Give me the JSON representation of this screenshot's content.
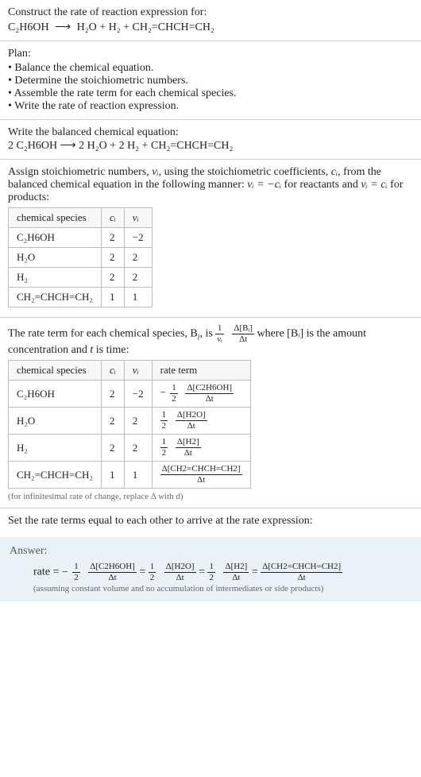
{
  "header": {
    "prompt": "Construct the rate of reaction expression for:",
    "equation_lhs": "C₂H6OH",
    "arrow": "⟶",
    "equation_rhs": "H₂O + H₂ + CH₂=CHCH=CH₂"
  },
  "plan": {
    "title": "Plan:",
    "items": [
      "• Balance the chemical equation.",
      "• Determine the stoichiometric numbers.",
      "• Assemble the rate term for each chemical species.",
      "• Write the rate of reaction expression."
    ]
  },
  "balanced": {
    "heading": "Write the balanced chemical equation:",
    "equation": "2 C₂H6OH  ⟶  2 H₂O + 2 H₂ + CH₂=CHCH=CH₂"
  },
  "stoich": {
    "text_a": "Assign stoichiometric numbers, ",
    "nu_i": "νᵢ",
    "text_b": ", using the stoichiometric coefficients, ",
    "c_i": "cᵢ",
    "text_c": ", from the balanced chemical equation in the following manner: ",
    "rel_reactants": "νᵢ = −cᵢ",
    "text_d": " for reactants and ",
    "rel_products": "νᵢ = cᵢ",
    "text_e": " for products:",
    "headers": {
      "species": "chemical species",
      "ci": "cᵢ",
      "nui": "νᵢ"
    },
    "rows": [
      {
        "species": "C₂H6OH",
        "ci": "2",
        "nui": "−2"
      },
      {
        "species": "H₂O",
        "ci": "2",
        "nui": "2"
      },
      {
        "species": "H₂",
        "ci": "2",
        "nui": "2"
      },
      {
        "species": "CH₂=CHCH=CH₂",
        "ci": "1",
        "nui": "1"
      }
    ]
  },
  "rateterm": {
    "intro_a": "The rate term for each chemical species, B",
    "intro_b": ", is ",
    "frac1_num": "1",
    "frac1_den": "νᵢ",
    "frac2_num": "Δ[Bᵢ]",
    "frac2_den": "Δt",
    "intro_c": " where [Bᵢ] is the amount concentration and ",
    "t": "t",
    "intro_d": " is time:",
    "headers": {
      "species": "chemical species",
      "ci": "cᵢ",
      "nui": "νᵢ",
      "rate": "rate term"
    },
    "rows": [
      {
        "species": "C₂H6OH",
        "ci": "2",
        "nui": "−2",
        "neg": "−",
        "coef_num": "1",
        "coef_den": "2",
        "d_num": "Δ[C2H6OH]",
        "d_den": "Δt"
      },
      {
        "species": "H₂O",
        "ci": "2",
        "nui": "2",
        "neg": "",
        "coef_num": "1",
        "coef_den": "2",
        "d_num": "Δ[H2O]",
        "d_den": "Δt"
      },
      {
        "species": "H₂",
        "ci": "2",
        "nui": "2",
        "neg": "",
        "coef_num": "1",
        "coef_den": "2",
        "d_num": "Δ[H2]",
        "d_den": "Δt"
      },
      {
        "species": "CH₂=CHCH=CH₂",
        "ci": "1",
        "nui": "1",
        "neg": "",
        "coef_num": "",
        "coef_den": "",
        "d_num": "Δ[CH2=CHCH=CH2]",
        "d_den": "Δt"
      }
    ],
    "note": "(for infinitesimal rate of change, replace Δ with d)"
  },
  "final": {
    "heading": "Set the rate terms equal to each other to arrive at the rate expression:"
  },
  "answer": {
    "label": "Answer:",
    "rate_eq_prefix": "rate = ",
    "terms": [
      {
        "neg": "−",
        "coef_num": "1",
        "coef_den": "2",
        "d_num": "Δ[C2H6OH]",
        "d_den": "Δt"
      },
      {
        "neg": "",
        "coef_num": "1",
        "coef_den": "2",
        "d_num": "Δ[H2O]",
        "d_den": "Δt"
      },
      {
        "neg": "",
        "coef_num": "1",
        "coef_den": "2",
        "d_num": "Δ[H2]",
        "d_den": "Δt"
      },
      {
        "neg": "",
        "coef_num": "",
        "coef_den": "",
        "d_num": "Δ[CH2=CHCH=CH2]",
        "d_den": "Δt"
      }
    ],
    "eq_sep": " = ",
    "note": "(assuming constant volume and no accumulation of intermediates or side products)"
  },
  "chart_data": {
    "type": "table",
    "tables": [
      {
        "title": "Stoichiometric numbers",
        "columns": [
          "chemical species",
          "c_i",
          "nu_i"
        ],
        "rows": [
          [
            "C2H6OH",
            2,
            -2
          ],
          [
            "H2O",
            2,
            2
          ],
          [
            "H2",
            2,
            2
          ],
          [
            "CH2=CHCH=CH2",
            1,
            1
          ]
        ]
      },
      {
        "title": "Rate terms",
        "columns": [
          "chemical species",
          "c_i",
          "nu_i",
          "rate term"
        ],
        "rows": [
          [
            "C2H6OH",
            2,
            -2,
            "-(1/2) d[C2H6OH]/dt"
          ],
          [
            "H2O",
            2,
            2,
            "(1/2) d[H2O]/dt"
          ],
          [
            "H2",
            2,
            2,
            "(1/2) d[H2]/dt"
          ],
          [
            "CH2=CHCH=CH2",
            1,
            1,
            "d[CH2=CHCH=CH2]/dt"
          ]
        ]
      }
    ],
    "rate_expression": "rate = -(1/2) d[C2H6OH]/dt = (1/2) d[H2O]/dt = (1/2) d[H2]/dt = d[CH2=CHCH=CH2]/dt"
  }
}
